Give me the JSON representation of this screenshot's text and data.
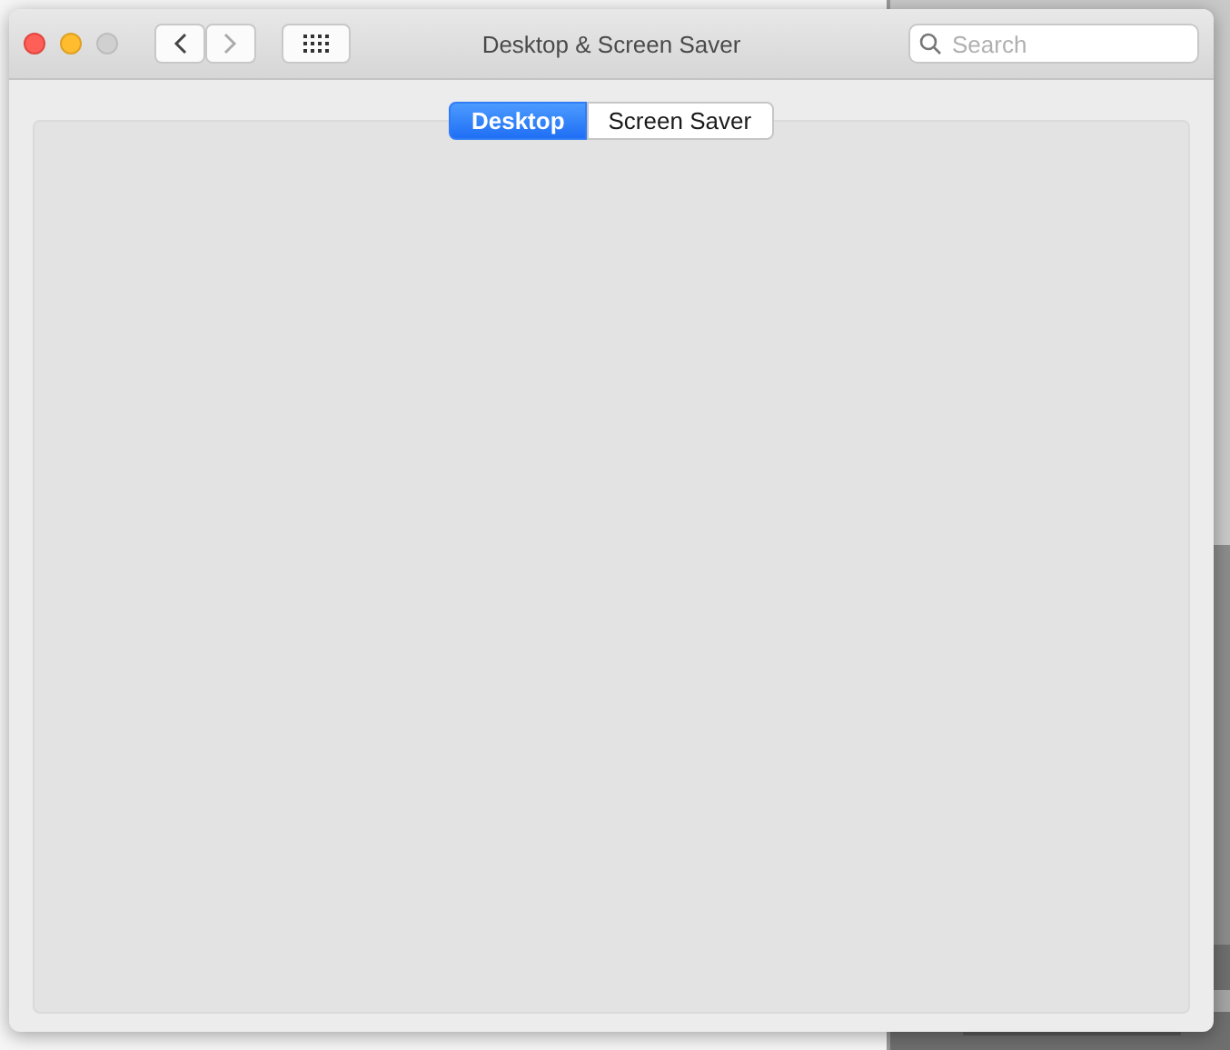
{
  "window": {
    "title": "Desktop & Screen Saver"
  },
  "search": {
    "placeholder": "Search"
  },
  "tabs": [
    {
      "label": "Desktop",
      "selected": true
    },
    {
      "label": "Screen Saver",
      "selected": false
    }
  ]
}
